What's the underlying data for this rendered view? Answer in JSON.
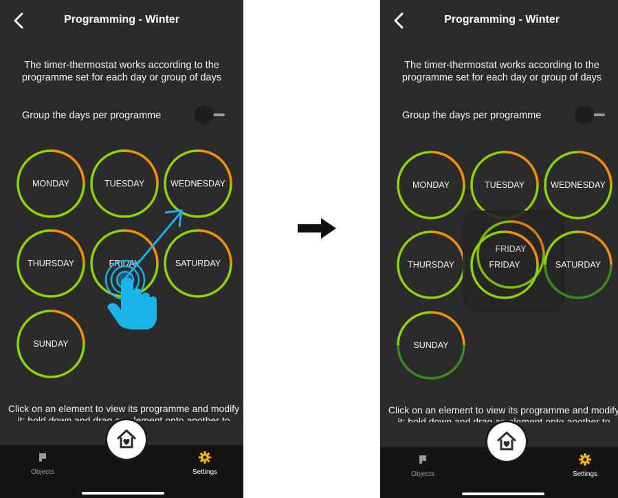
{
  "screens": [
    {
      "title": "Programming - Winter",
      "description": "The timer-thermostat works according to the programme set for each day or group of days",
      "group_label": "Group the days per programme",
      "days": [
        "MONDAY",
        "TUESDAY",
        "WEDNESDAY",
        "THURSDAY",
        "FRIDAY",
        "SATURDAY",
        "SUNDAY"
      ],
      "footer": "Click on an element to view its programme and modify it; hold down and drag an element onto another to copy",
      "tabs": [
        "Objects",
        "Settings"
      ]
    },
    {
      "title": "Programming - Winter",
      "description": "The timer-thermostat works according to the programme set for each day or group of days",
      "group_label": "Group the days per programme",
      "days": [
        "MONDAY",
        "TUESDAY",
        "WEDNESDAY",
        "THURSDAY",
        "FRIDAY",
        "SATURDAY",
        "SUNDAY"
      ],
      "dragged_day": "FRIDAY",
      "footer": "Click on an element to view its programme and modify it; hold down and drag an element onto another to copy",
      "tabs": [
        "Objects",
        "Settings"
      ]
    }
  ],
  "colors": {
    "background": "#2b2b2b",
    "ring_green": "#8fd400",
    "ring_orange": "#ff8c00",
    "ring_dark_green": "#3c8b1e",
    "gesture_blue": "#1ab2e8",
    "settings_icon": "#f5b400"
  },
  "icons": [
    "back-chevron-icon",
    "toggle-switch",
    "objects-icon",
    "home-heart-icon",
    "gear-icon",
    "tap-hand-icon",
    "drag-arrow-icon",
    "right-arrow-icon"
  ]
}
